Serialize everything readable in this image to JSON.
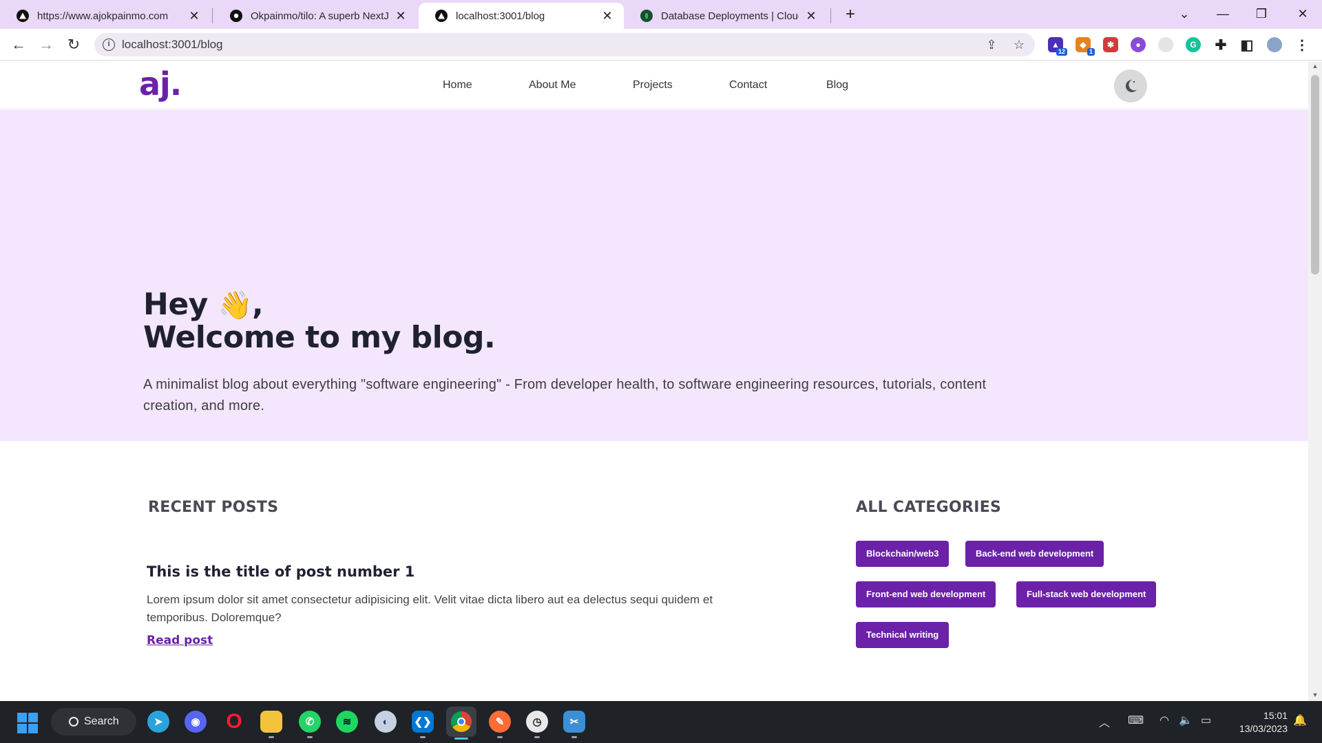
{
  "browser": {
    "tabs": [
      {
        "title": "https://www.ajokpainmo.com",
        "icon": "vercel-triangle-icon",
        "active": false
      },
      {
        "title": "Okpainmo/tilo: A superb NextJS",
        "icon": "github-icon",
        "active": false
      },
      {
        "title": "localhost:3001/blog",
        "icon": "vercel-triangle-icon",
        "active": true
      },
      {
        "title": "Database Deployments | Cloud: M",
        "icon": "mongodb-leaf-icon",
        "active": false
      }
    ],
    "address": "localhost:3001/blog",
    "new_tab_label": "+"
  },
  "site": {
    "logo": "aj.",
    "nav": [
      "Home",
      "About Me",
      "Projects",
      "Contact",
      "Blog"
    ],
    "theme_icon": "moon-icon",
    "accent_color": "#6b21a8"
  },
  "hero": {
    "greeting": "Hey",
    "wave": "👋",
    "comma": ",",
    "headline": "Welcome to my blog.",
    "description": "A minimalist blog about everything \"software engineering\" - From developer health, to software engineering resources, tutorials, content creation, and more."
  },
  "recent": {
    "heading": "RECENT POSTS",
    "posts": [
      {
        "title": "This is the title of post number 1",
        "excerpt": "Lorem ipsum dolor sit amet consectetur adipisicing elit. Velit vitae dicta libero aut ea delectus sequi quidem et temporibus. Doloremque?",
        "link": "Read post"
      }
    ]
  },
  "categories": {
    "heading": "ALL CATEGORIES",
    "items": [
      "Blockchain/web3",
      "Back-end web development",
      "Front-end web development",
      "Full-stack web development",
      "Technical writing"
    ]
  },
  "taskbar": {
    "search": "Search",
    "time": "15:01",
    "date": "13/03/2023"
  }
}
